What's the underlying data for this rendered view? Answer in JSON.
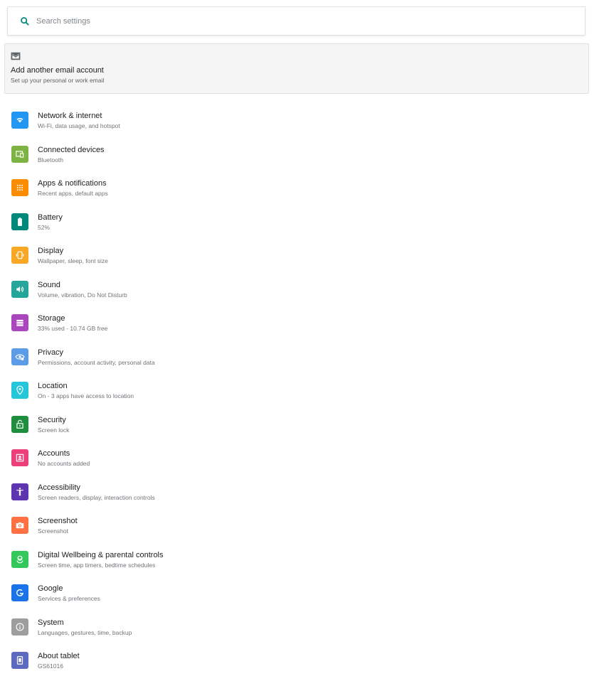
{
  "search": {
    "placeholder": "Search settings"
  },
  "suggestion": {
    "icon": "mail-icon",
    "title": "Add another email account",
    "summary": "Set up your personal or work email"
  },
  "settings": [
    {
      "title": "Network & internet",
      "summary": "Wi-Fi, data usage, and hotspot",
      "icon": "wifi-icon",
      "color": "#2196f3"
    },
    {
      "title": "Connected devices",
      "summary": "Bluetooth",
      "icon": "devices-icon",
      "color": "#7cb342"
    },
    {
      "title": "Apps & notifications",
      "summary": "Recent apps, default apps",
      "icon": "apps-icon",
      "color": "#fb8c00"
    },
    {
      "title": "Battery",
      "summary": "52%",
      "icon": "battery-icon",
      "color": "#00897b"
    },
    {
      "title": "Display",
      "summary": "Wallpaper, sleep, font size",
      "icon": "display-icon",
      "color": "#f9a825"
    },
    {
      "title": "Sound",
      "summary": "Volume, vibration, Do Not Disturb",
      "icon": "sound-icon",
      "color": "#26a69a"
    },
    {
      "title": "Storage",
      "summary": "33% used - 10.74 GB free",
      "icon": "storage-icon",
      "color": "#ab47bc"
    },
    {
      "title": "Privacy",
      "summary": "Permissions, account activity, personal data",
      "icon": "privacy-icon",
      "color": "#5c9ce6"
    },
    {
      "title": "Location",
      "summary": "On - 3 apps have access to location",
      "icon": "location-icon",
      "color": "#26c6da"
    },
    {
      "title": "Security",
      "summary": "Screen lock",
      "icon": "lock-icon",
      "color": "#1e8e3e"
    },
    {
      "title": "Accounts",
      "summary": "No accounts added",
      "icon": "accounts-icon",
      "color": "#ec407a"
    },
    {
      "title": "Accessibility",
      "summary": "Screen readers, display, interaction controls",
      "icon": "accessibility-icon",
      "color": "#5e35b1"
    },
    {
      "title": "Screenshot",
      "summary": "Screenshot",
      "icon": "camera-icon",
      "color": "#ff7043"
    },
    {
      "title": "Digital Wellbeing & parental controls",
      "summary": "Screen time, app timers, bedtime schedules",
      "icon": "wellbeing-icon",
      "color": "#34c759"
    },
    {
      "title": "Google",
      "summary": "Services & preferences",
      "icon": "google-icon",
      "color": "#1a73e8"
    },
    {
      "title": "System",
      "summary": "Languages, gestures, time, backup",
      "icon": "system-info-icon",
      "color": "#9e9e9e"
    },
    {
      "title": "About tablet",
      "summary": "GS61016",
      "icon": "tablet-icon",
      "color": "#5c6bc0"
    }
  ]
}
